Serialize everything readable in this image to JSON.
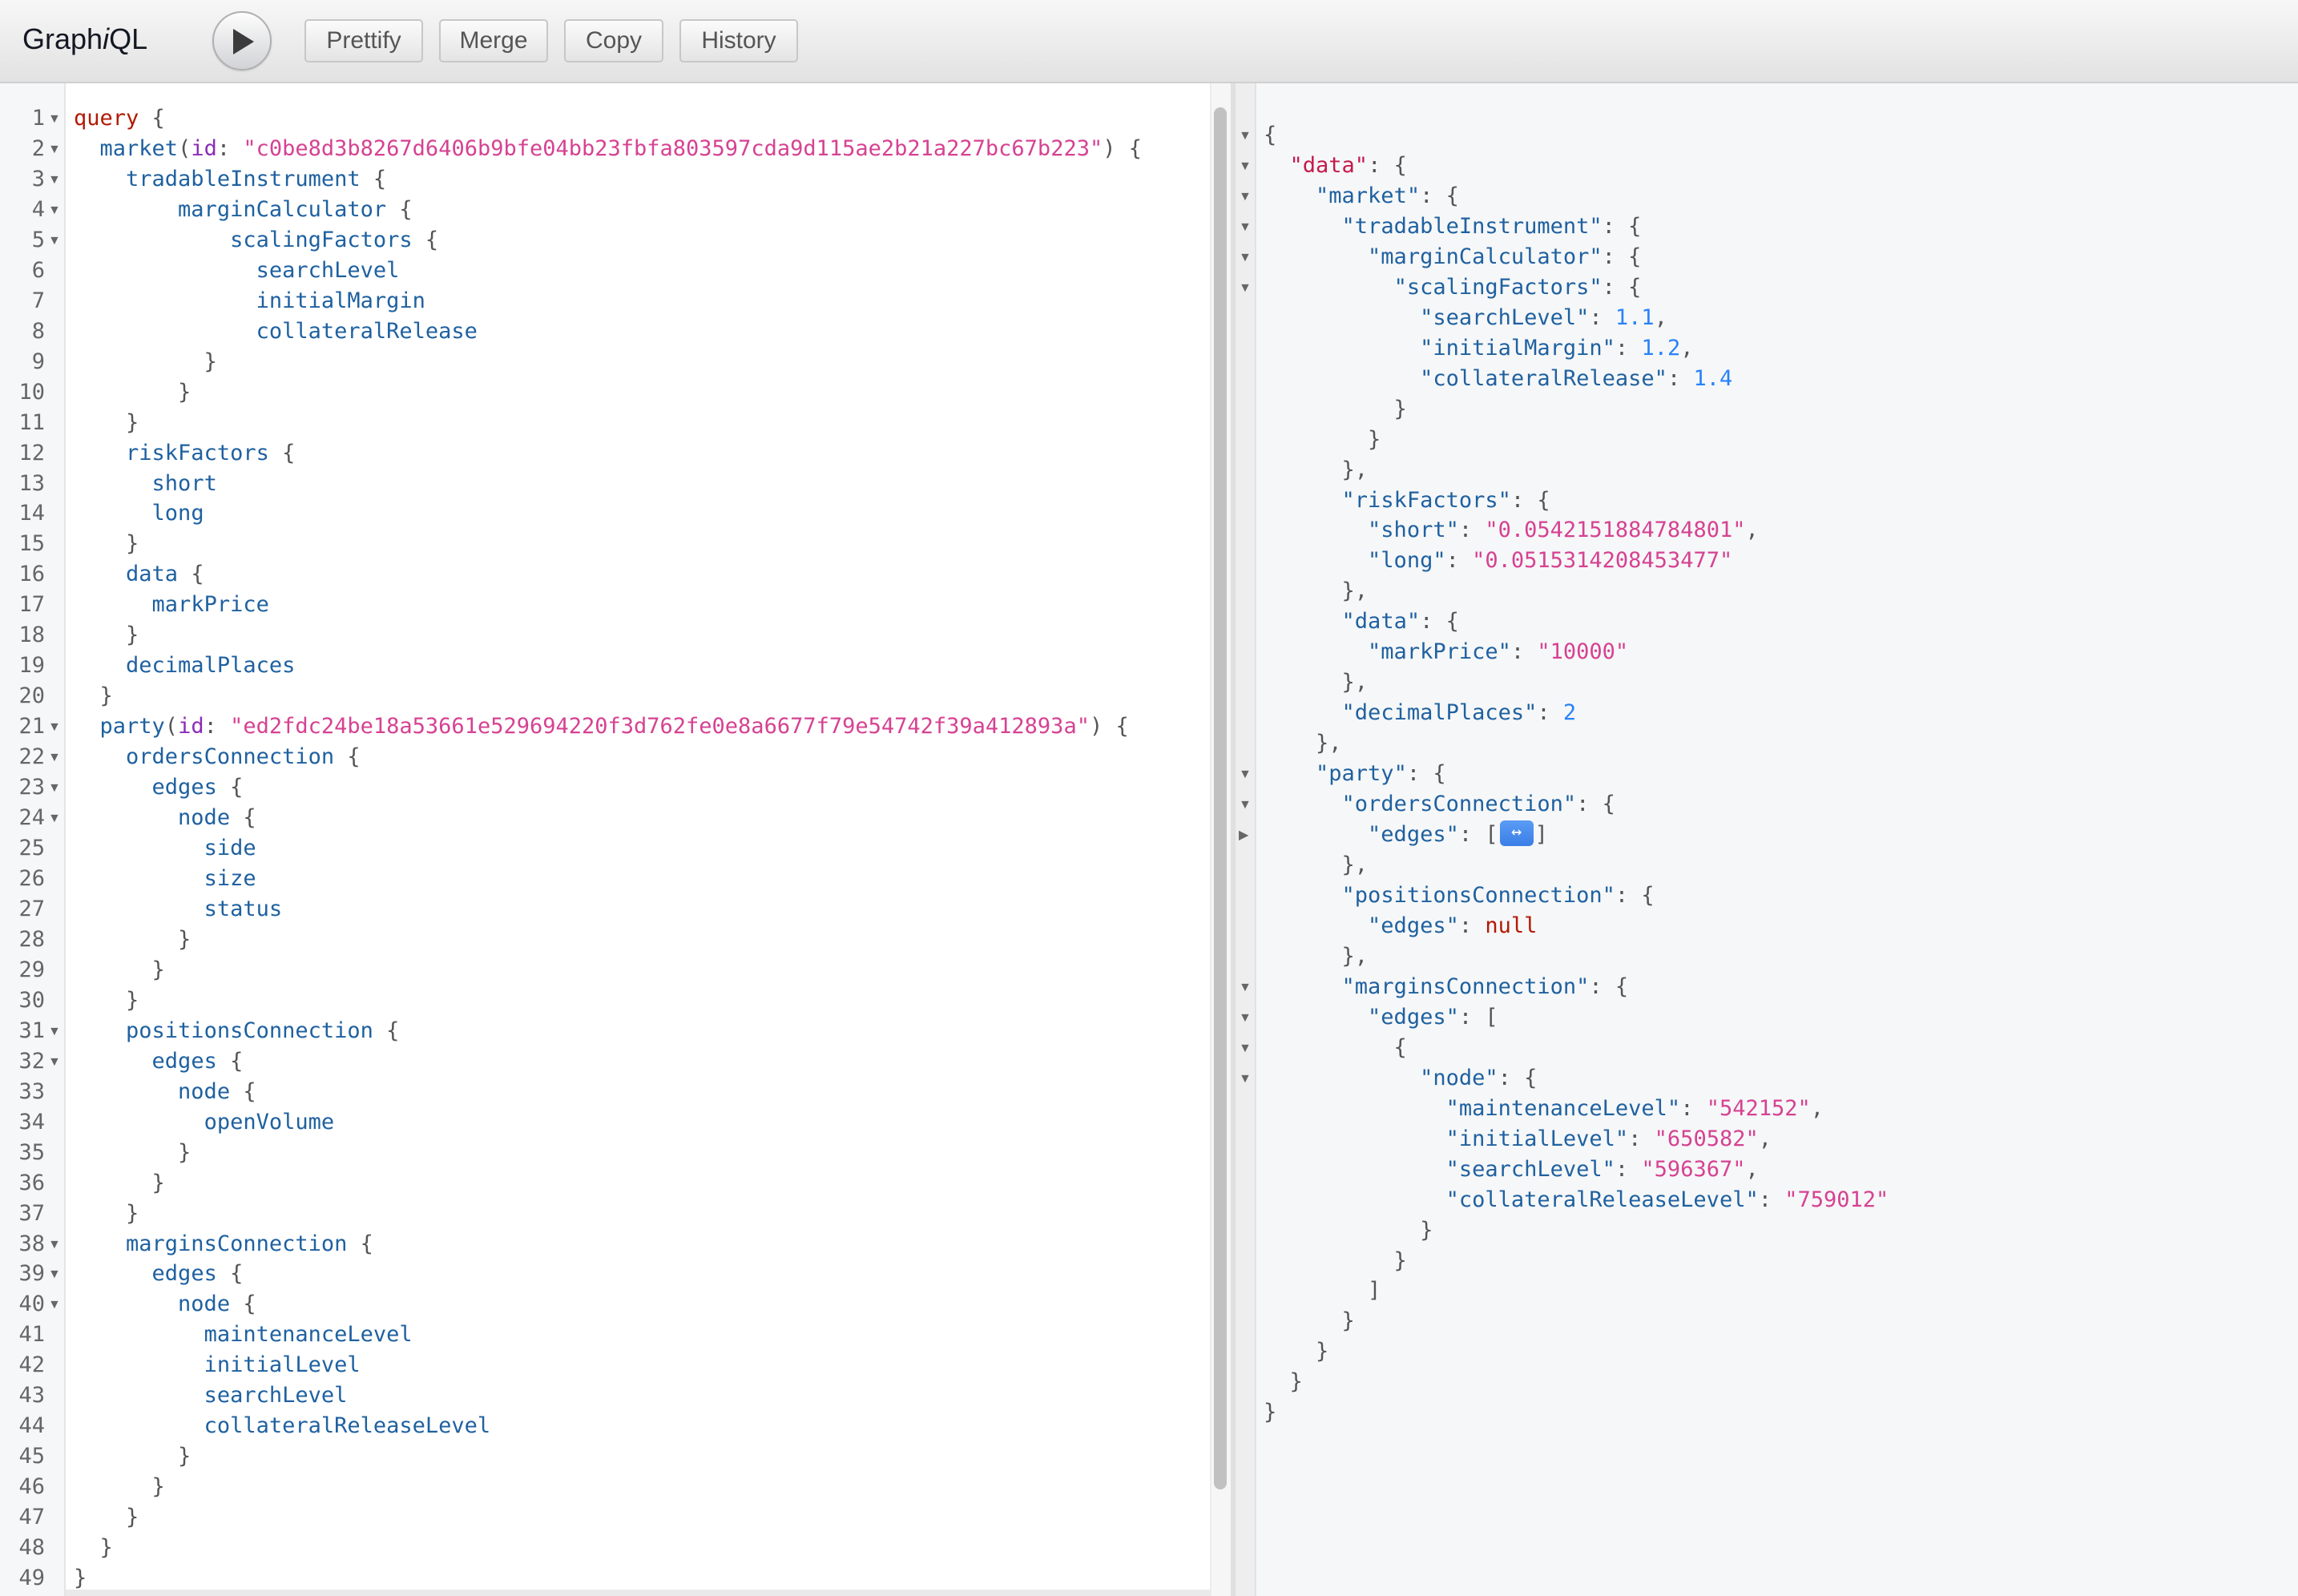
{
  "app": {
    "title_prefix": "Graph",
    "title_italic": "i",
    "title_suffix": "QL"
  },
  "toolbar": {
    "execute_icon": "play-icon",
    "buttons": [
      "Prettify",
      "Merge",
      "Copy",
      "History"
    ]
  },
  "query_editor": {
    "lines": [
      [
        [
          "kw",
          "query"
        ],
        [
          "pn",
          " {"
        ]
      ],
      [
        [
          "pn",
          "  "
        ],
        [
          "fld",
          "market"
        ],
        [
          "pn",
          "("
        ],
        [
          "attr",
          "id"
        ],
        [
          "pn",
          ": "
        ],
        [
          "str",
          "\"c0be8d3b8267d6406b9bfe04bb23fbfa803597cda9d115ae2b21a227bc67b223\""
        ],
        [
          "pn",
          ") {"
        ]
      ],
      [
        [
          "pn",
          "    "
        ],
        [
          "fld",
          "tradableInstrument"
        ],
        [
          "pn",
          " {"
        ]
      ],
      [
        [
          "pn",
          "        "
        ],
        [
          "fld",
          "marginCalculator"
        ],
        [
          "pn",
          " {"
        ]
      ],
      [
        [
          "pn",
          "            "
        ],
        [
          "fld",
          "scalingFactors"
        ],
        [
          "pn",
          " {"
        ]
      ],
      [
        [
          "pn",
          "              "
        ],
        [
          "fld",
          "searchLevel"
        ]
      ],
      [
        [
          "pn",
          "              "
        ],
        [
          "fld",
          "initialMargin"
        ]
      ],
      [
        [
          "pn",
          "              "
        ],
        [
          "fld",
          "collateralRelease"
        ]
      ],
      [
        [
          "pn",
          "          }"
        ]
      ],
      [
        [
          "pn",
          "        }"
        ]
      ],
      [
        [
          "pn",
          "    }"
        ]
      ],
      [
        [
          "pn",
          "    "
        ],
        [
          "fld",
          "riskFactors"
        ],
        [
          "pn",
          " {"
        ]
      ],
      [
        [
          "pn",
          "      "
        ],
        [
          "fld",
          "short"
        ]
      ],
      [
        [
          "pn",
          "      "
        ],
        [
          "fld",
          "long"
        ]
      ],
      [
        [
          "pn",
          "    }"
        ]
      ],
      [
        [
          "pn",
          "    "
        ],
        [
          "fld",
          "data"
        ],
        [
          "pn",
          " {"
        ]
      ],
      [
        [
          "pn",
          "      "
        ],
        [
          "fld",
          "markPrice"
        ]
      ],
      [
        [
          "pn",
          "    }"
        ]
      ],
      [
        [
          "pn",
          "    "
        ],
        [
          "fld",
          "decimalPlaces"
        ]
      ],
      [
        [
          "pn",
          "  }"
        ]
      ],
      [
        [
          "pn",
          "  "
        ],
        [
          "fld",
          "party"
        ],
        [
          "pn",
          "("
        ],
        [
          "attr",
          "id"
        ],
        [
          "pn",
          ": "
        ],
        [
          "str",
          "\"ed2fdc24be18a53661e529694220f3d762fe0e8a6677f79e54742f39a412893a\""
        ],
        [
          "pn",
          ") {"
        ]
      ],
      [
        [
          "pn",
          "    "
        ],
        [
          "fld",
          "ordersConnection"
        ],
        [
          "pn",
          " {"
        ]
      ],
      [
        [
          "pn",
          "      "
        ],
        [
          "fld",
          "edges"
        ],
        [
          "pn",
          " {"
        ]
      ],
      [
        [
          "pn",
          "        "
        ],
        [
          "fld",
          "node"
        ],
        [
          "pn",
          " {"
        ]
      ],
      [
        [
          "pn",
          "          "
        ],
        [
          "fld",
          "side"
        ]
      ],
      [
        [
          "pn",
          "          "
        ],
        [
          "fld",
          "size"
        ]
      ],
      [
        [
          "pn",
          "          "
        ],
        [
          "fld",
          "status"
        ]
      ],
      [
        [
          "pn",
          "        }"
        ]
      ],
      [
        [
          "pn",
          "      }"
        ]
      ],
      [
        [
          "pn",
          "    }"
        ]
      ],
      [
        [
          "pn",
          "    "
        ],
        [
          "fld",
          "positionsConnection"
        ],
        [
          "pn",
          " {"
        ]
      ],
      [
        [
          "pn",
          "      "
        ],
        [
          "fld",
          "edges"
        ],
        [
          "pn",
          " {"
        ]
      ],
      [
        [
          "pn",
          "        "
        ],
        [
          "fld",
          "node"
        ],
        [
          "pn",
          " {"
        ]
      ],
      [
        [
          "pn",
          "          "
        ],
        [
          "fld",
          "openVolume"
        ]
      ],
      [
        [
          "pn",
          "        }"
        ]
      ],
      [
        [
          "pn",
          "      }"
        ]
      ],
      [
        [
          "pn",
          "    }"
        ]
      ],
      [
        [
          "pn",
          "    "
        ],
        [
          "fld",
          "marginsConnection"
        ],
        [
          "pn",
          " {"
        ]
      ],
      [
        [
          "pn",
          "      "
        ],
        [
          "fld",
          "edges"
        ],
        [
          "pn",
          " {"
        ]
      ],
      [
        [
          "pn",
          "        "
        ],
        [
          "fld",
          "node"
        ],
        [
          "pn",
          " {"
        ]
      ],
      [
        [
          "pn",
          "          "
        ],
        [
          "fld",
          "maintenanceLevel"
        ]
      ],
      [
        [
          "pn",
          "          "
        ],
        [
          "fld",
          "initialLevel"
        ]
      ],
      [
        [
          "pn",
          "          "
        ],
        [
          "fld",
          "searchLevel"
        ]
      ],
      [
        [
          "pn",
          "          "
        ],
        [
          "fld",
          "collateralReleaseLevel"
        ]
      ],
      [
        [
          "pn",
          "        }"
        ]
      ],
      [
        [
          "pn",
          "      }"
        ]
      ],
      [
        [
          "pn",
          "    }"
        ]
      ],
      [
        [
          "pn",
          "  }"
        ]
      ],
      [
        [
          "pn",
          "}"
        ]
      ]
    ],
    "foldable_lines": [
      1,
      2,
      3,
      4,
      5,
      21,
      22,
      23,
      24,
      31,
      32,
      38,
      39,
      40
    ]
  },
  "result_viewer": {
    "lines": [
      {
        "fold": "open",
        "tokens": [
          [
            "pn",
            "{"
          ]
        ]
      },
      {
        "fold": "open",
        "tokens": [
          [
            "pn",
            "  "
          ],
          [
            "rdata",
            "\"data\""
          ],
          [
            "pn",
            ": {"
          ]
        ]
      },
      {
        "fold": "open",
        "tokens": [
          [
            "pn",
            "    "
          ],
          [
            "rkey",
            "\"market\""
          ],
          [
            "pn",
            ": {"
          ]
        ]
      },
      {
        "fold": "open",
        "tokens": [
          [
            "pn",
            "      "
          ],
          [
            "rkey",
            "\"tradableInstrument\""
          ],
          [
            "pn",
            ": {"
          ]
        ]
      },
      {
        "fold": "open",
        "tokens": [
          [
            "pn",
            "        "
          ],
          [
            "rkey",
            "\"marginCalculator\""
          ],
          [
            "pn",
            ": {"
          ]
        ]
      },
      {
        "fold": "open",
        "tokens": [
          [
            "pn",
            "          "
          ],
          [
            "rkey",
            "\"scalingFactors\""
          ],
          [
            "pn",
            ": {"
          ]
        ]
      },
      {
        "fold": "",
        "tokens": [
          [
            "pn",
            "            "
          ],
          [
            "rkey",
            "\"searchLevel\""
          ],
          [
            "pn",
            ": "
          ],
          [
            "num",
            "1.1"
          ],
          [
            "pn",
            ","
          ]
        ]
      },
      {
        "fold": "",
        "tokens": [
          [
            "pn",
            "            "
          ],
          [
            "rkey",
            "\"initialMargin\""
          ],
          [
            "pn",
            ": "
          ],
          [
            "num",
            "1.2"
          ],
          [
            "pn",
            ","
          ]
        ]
      },
      {
        "fold": "",
        "tokens": [
          [
            "pn",
            "            "
          ],
          [
            "rkey",
            "\"collateralRelease\""
          ],
          [
            "pn",
            ": "
          ],
          [
            "num",
            "1.4"
          ]
        ]
      },
      {
        "fold": "",
        "tokens": [
          [
            "pn",
            "          }"
          ]
        ]
      },
      {
        "fold": "",
        "tokens": [
          [
            "pn",
            "        }"
          ]
        ]
      },
      {
        "fold": "",
        "tokens": [
          [
            "pn",
            "      },"
          ]
        ]
      },
      {
        "fold": "",
        "tokens": [
          [
            "pn",
            "      "
          ],
          [
            "rkey",
            "\"riskFactors\""
          ],
          [
            "pn",
            ": {"
          ]
        ]
      },
      {
        "fold": "",
        "tokens": [
          [
            "pn",
            "        "
          ],
          [
            "rkey",
            "\"short\""
          ],
          [
            "pn",
            ": "
          ],
          [
            "str",
            "\"0.0542151884784801\""
          ],
          [
            "pn",
            ","
          ]
        ]
      },
      {
        "fold": "",
        "tokens": [
          [
            "pn",
            "        "
          ],
          [
            "rkey",
            "\"long\""
          ],
          [
            "pn",
            ": "
          ],
          [
            "str",
            "\"0.0515314208453477\""
          ]
        ]
      },
      {
        "fold": "",
        "tokens": [
          [
            "pn",
            "      },"
          ]
        ]
      },
      {
        "fold": "",
        "tokens": [
          [
            "pn",
            "      "
          ],
          [
            "rkey",
            "\"data\""
          ],
          [
            "pn",
            ": {"
          ]
        ]
      },
      {
        "fold": "",
        "tokens": [
          [
            "pn",
            "        "
          ],
          [
            "rkey",
            "\"markPrice\""
          ],
          [
            "pn",
            ": "
          ],
          [
            "str",
            "\"10000\""
          ]
        ]
      },
      {
        "fold": "",
        "tokens": [
          [
            "pn",
            "      },"
          ]
        ]
      },
      {
        "fold": "",
        "tokens": [
          [
            "pn",
            "      "
          ],
          [
            "rkey",
            "\"decimalPlaces\""
          ],
          [
            "pn",
            ": "
          ],
          [
            "num",
            "2"
          ]
        ]
      },
      {
        "fold": "",
        "tokens": [
          [
            "pn",
            "    },"
          ]
        ]
      },
      {
        "fold": "open",
        "tokens": [
          [
            "pn",
            "    "
          ],
          [
            "rkey",
            "\"party\""
          ],
          [
            "pn",
            ": {"
          ]
        ]
      },
      {
        "fold": "open",
        "tokens": [
          [
            "pn",
            "      "
          ],
          [
            "rkey",
            "\"ordersConnection\""
          ],
          [
            "pn",
            ": {"
          ]
        ]
      },
      {
        "fold": "closed",
        "tokens": [
          [
            "pn",
            "        "
          ],
          [
            "rkey",
            "\"edges\""
          ],
          [
            "pn",
            ": ["
          ],
          [
            "widget",
            "↔"
          ],
          [
            "pn",
            "]"
          ]
        ]
      },
      {
        "fold": "",
        "tokens": [
          [
            "pn",
            "      },"
          ]
        ]
      },
      {
        "fold": "",
        "tokens": [
          [
            "pn",
            "      "
          ],
          [
            "rkey",
            "\"positionsConnection\""
          ],
          [
            "pn",
            ": {"
          ]
        ]
      },
      {
        "fold": "",
        "tokens": [
          [
            "pn",
            "        "
          ],
          [
            "rkey",
            "\"edges\""
          ],
          [
            "pn",
            ": "
          ],
          [
            "nul",
            "null"
          ]
        ]
      },
      {
        "fold": "",
        "tokens": [
          [
            "pn",
            "      },"
          ]
        ]
      },
      {
        "fold": "open",
        "tokens": [
          [
            "pn",
            "      "
          ],
          [
            "rkey",
            "\"marginsConnection\""
          ],
          [
            "pn",
            ": {"
          ]
        ]
      },
      {
        "fold": "open",
        "tokens": [
          [
            "pn",
            "        "
          ],
          [
            "rkey",
            "\"edges\""
          ],
          [
            "pn",
            ": ["
          ]
        ]
      },
      {
        "fold": "open",
        "tokens": [
          [
            "pn",
            "          {"
          ]
        ]
      },
      {
        "fold": "open",
        "tokens": [
          [
            "pn",
            "            "
          ],
          [
            "rkey",
            "\"node\""
          ],
          [
            "pn",
            ": {"
          ]
        ]
      },
      {
        "fold": "",
        "tokens": [
          [
            "pn",
            "              "
          ],
          [
            "rkey",
            "\"maintenanceLevel\""
          ],
          [
            "pn",
            ": "
          ],
          [
            "str",
            "\"542152\""
          ],
          [
            "pn",
            ","
          ]
        ]
      },
      {
        "fold": "",
        "tokens": [
          [
            "pn",
            "              "
          ],
          [
            "rkey",
            "\"initialLevel\""
          ],
          [
            "pn",
            ": "
          ],
          [
            "str",
            "\"650582\""
          ],
          [
            "pn",
            ","
          ]
        ]
      },
      {
        "fold": "",
        "tokens": [
          [
            "pn",
            "              "
          ],
          [
            "rkey",
            "\"searchLevel\""
          ],
          [
            "pn",
            ": "
          ],
          [
            "str",
            "\"596367\""
          ],
          [
            "pn",
            ","
          ]
        ]
      },
      {
        "fold": "",
        "tokens": [
          [
            "pn",
            "              "
          ],
          [
            "rkey",
            "\"collateralReleaseLevel\""
          ],
          [
            "pn",
            ": "
          ],
          [
            "str",
            "\"759012\""
          ]
        ]
      },
      {
        "fold": "",
        "tokens": [
          [
            "pn",
            "            }"
          ]
        ]
      },
      {
        "fold": "",
        "tokens": [
          [
            "pn",
            "          }"
          ]
        ]
      },
      {
        "fold": "",
        "tokens": [
          [
            "pn",
            "        ]"
          ]
        ]
      },
      {
        "fold": "",
        "tokens": [
          [
            "pn",
            "      }"
          ]
        ]
      },
      {
        "fold": "",
        "tokens": [
          [
            "pn",
            "    }"
          ]
        ]
      },
      {
        "fold": "",
        "tokens": [
          [
            "pn",
            "  }"
          ]
        ]
      },
      {
        "fold": "",
        "tokens": [
          [
            "pn",
            "}"
          ]
        ]
      }
    ]
  },
  "colors": {
    "keyword": "#b11a04",
    "field": "#1f61a0",
    "attribute": "#8b2bb9",
    "string": "#d64292",
    "number": "#2882f9",
    "null": "#b11a04",
    "data_key": "#c41a4a",
    "punctuation": "#555555"
  }
}
